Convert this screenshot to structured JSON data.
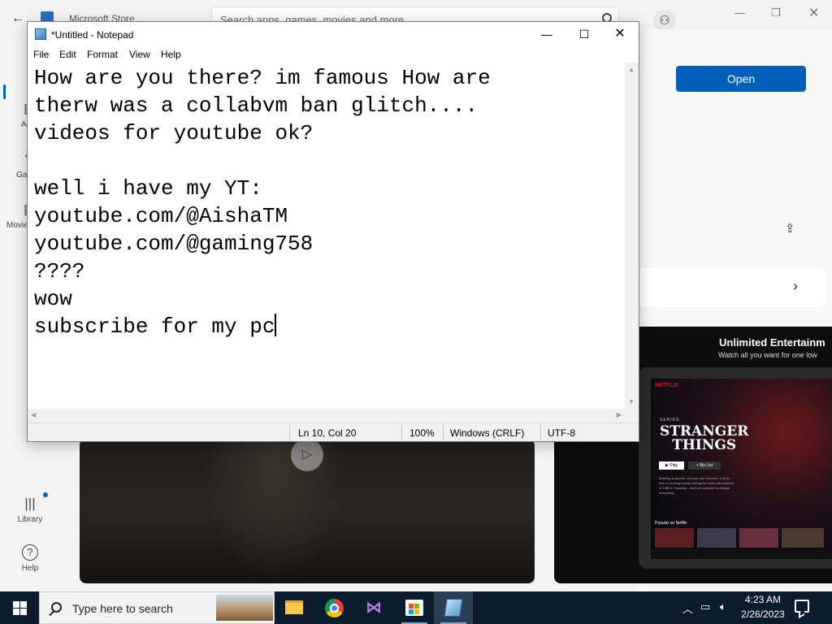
{
  "store": {
    "title": "Microsoft Store",
    "search_placeholder": "Search apps, games, movies and more",
    "open_button": "Open",
    "nav": {
      "apps_label": "Ap",
      "gaming_label": "Gan",
      "movies_label": "Movie",
      "library_label": "Library",
      "help_label": "Help"
    },
    "promo": {
      "headline": "Unlimited Entertainm",
      "subhead": "Watch all you want for one low",
      "netflix_logo": "NETFLIX",
      "series_tag": "SERIES",
      "show_title_line1": "STRANGER",
      "show_title_line2": "THINGS",
      "play_label": "▶ Play",
      "mylist_label": "+ My List",
      "description": "Building suspense. A brand-new menace. A rebel who is working toward saving the world this summer of 1985 in Hawkins... and one summer to change everything.",
      "popular_label": "Popular on Netflix"
    }
  },
  "notepad": {
    "title": "*Untitled - Notepad",
    "menu": [
      "File",
      "Edit",
      "Format",
      "View",
      "Help"
    ],
    "text": "How are you there? im famous How are\ntherw was a collabvm ban glitch....\nvideos for youtube ok?\n\nwell i have my YT:\nyoutube.com/@AishaTM\nyoutube.com/@gaming758\n????\nwow\nsubscribe for my pc",
    "status": {
      "position": "Ln 10, Col 20",
      "zoom": "100%",
      "line_ending": "Windows (CRLF)",
      "encoding": "UTF-8"
    }
  },
  "taskbar": {
    "search_placeholder": "Type here to search",
    "time": "4:23 AM",
    "date": "2/26/2023",
    "pinned_apps": [
      "file-explorer",
      "google-chrome",
      "visual-studio",
      "microsoft-store",
      "notepad"
    ]
  },
  "colors": {
    "store_accent": "#005fb8",
    "taskbar_bg": "#0c1c2e",
    "netflix_red": "#e50914"
  }
}
